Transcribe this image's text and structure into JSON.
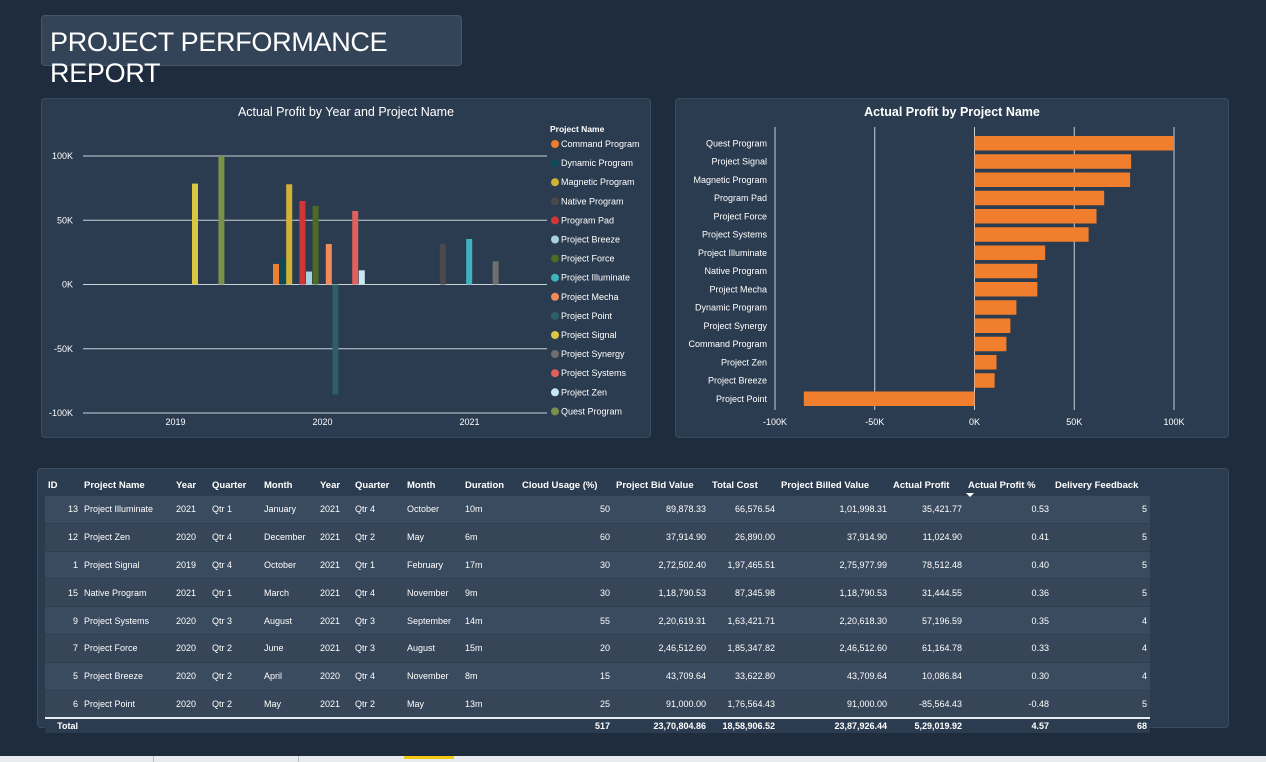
{
  "report": {
    "title": "PROJECT PERFORMANCE REPORT"
  },
  "colors": {
    "background": "#1e2c3d",
    "panel": "#2c3c50",
    "bar_orange": "#f07e2c"
  },
  "chart_data": [
    {
      "type": "bar",
      "title": "Actual Profit by Year and Project Name",
      "categories": [
        "2019",
        "2020",
        "2021"
      ],
      "ylim": [
        -100000,
        100000
      ],
      "yticks": [
        -100000,
        -50000,
        0,
        50000,
        100000
      ],
      "ytick_labels": [
        "-100K",
        "-50K",
        "0K",
        "50K",
        "100K"
      ],
      "grid": true,
      "legend": {
        "title": "Project Name",
        "placement": "right"
      },
      "series": [
        {
          "name": "Command Program",
          "color": "#f07e2c",
          "values": [
            0,
            16000,
            0
          ]
        },
        {
          "name": "Dynamic Program",
          "color": "#0e4a5a",
          "values": [
            0,
            20000,
            0
          ]
        },
        {
          "name": "Magnetic Program",
          "color": "#d2b234",
          "values": [
            0,
            78000,
            0
          ]
        },
        {
          "name": "Native Program",
          "color": "#4a4a4a",
          "values": [
            0,
            0,
            31444.55
          ]
        },
        {
          "name": "Program Pad",
          "color": "#d03538",
          "values": [
            0,
            65000,
            0
          ]
        },
        {
          "name": "Project Breeze",
          "color": "#a7d2e0",
          "values": [
            0,
            10086.84,
            0
          ]
        },
        {
          "name": "Project Force",
          "color": "#4d6b24",
          "values": [
            0,
            61164.78,
            0
          ]
        },
        {
          "name": "Project Illuminate",
          "color": "#3fb3bd",
          "values": [
            0,
            0,
            35421.77
          ]
        },
        {
          "name": "Project Mecha",
          "color": "#f08c5a",
          "values": [
            0,
            31500,
            0
          ]
        },
        {
          "name": "Project Point",
          "color": "#2d5e69",
          "values": [
            0,
            -85564.43,
            0
          ]
        },
        {
          "name": "Project Signal",
          "color": "#dcc743",
          "values": [
            78512.48,
            0,
            0
          ]
        },
        {
          "name": "Project Synergy",
          "color": "#6f6f6f",
          "values": [
            0,
            0,
            18000
          ]
        },
        {
          "name": "Project Systems",
          "color": "#e0605a",
          "values": [
            0,
            57196.59,
            0
          ]
        },
        {
          "name": "Project Zen",
          "color": "#c9e8f2",
          "values": [
            0,
            11024.9,
            0
          ]
        },
        {
          "name": "Quest Program",
          "color": "#7a904b",
          "values": [
            100000,
            0,
            0
          ]
        }
      ]
    },
    {
      "type": "bar",
      "orientation": "horizontal",
      "title": "Actual Profit by Project Name",
      "color": "#f07e2c",
      "xlim": [
        -100000,
        100000
      ],
      "xticks": [
        -100000,
        -50000,
        0,
        50000,
        100000
      ],
      "xtick_labels": [
        "-100K",
        "-50K",
        "0K",
        "50K",
        "100K"
      ],
      "grid": true,
      "categories": [
        "Quest Program",
        "Project Signal",
        "Magnetic Program",
        "Program Pad",
        "Project Force",
        "Project Systems",
        "Project Illuminate",
        "Native Program",
        "Project Mecha",
        "Dynamic Program",
        "Project Synergy",
        "Command Program",
        "Project Zen",
        "Project Breeze",
        "Project Point"
      ],
      "values": [
        100000,
        78512.48,
        78000,
        65000,
        61164.78,
        57196.59,
        35421.77,
        31444.55,
        31500,
        21000,
        18000,
        16000,
        11024.9,
        10086.84,
        -85564.43
      ]
    }
  ],
  "table": {
    "columns": [
      "ID",
      "Project Name",
      "Year",
      "Quarter",
      "Month",
      "Year",
      "Quarter",
      "Month",
      "Duration",
      "Cloud Usage (%)",
      "Project Bid Value",
      "Total Cost",
      "Project Billed Value",
      "Actual Profit",
      "Actual Profit %",
      "Delivery Feedback"
    ],
    "sorted_column": "Actual Profit %",
    "rows": [
      [
        "13",
        "Project Illuminate",
        "2021",
        "Qtr 1",
        "January",
        "2021",
        "Qtr 4",
        "October",
        "10m",
        "50",
        "89,878.33",
        "66,576.54",
        "1,01,998.31",
        "35,421.77",
        "0.53",
        "5"
      ],
      [
        "12",
        "Project Zen",
        "2020",
        "Qtr 4",
        "December",
        "2021",
        "Qtr 2",
        "May",
        "6m",
        "60",
        "37,914.90",
        "26,890.00",
        "37,914.90",
        "11,024.90",
        "0.41",
        "5"
      ],
      [
        "1",
        "Project Signal",
        "2019",
        "Qtr 4",
        "October",
        "2021",
        "Qtr 1",
        "February",
        "17m",
        "30",
        "2,72,502.40",
        "1,97,465.51",
        "2,75,977.99",
        "78,512.48",
        "0.40",
        "5"
      ],
      [
        "15",
        "Native Program",
        "2021",
        "Qtr 1",
        "March",
        "2021",
        "Qtr 4",
        "November",
        "9m",
        "30",
        "1,18,790.53",
        "87,345.98",
        "1,18,790.53",
        "31,444.55",
        "0.36",
        "5"
      ],
      [
        "9",
        "Project Systems",
        "2020",
        "Qtr 3",
        "August",
        "2021",
        "Qtr 3",
        "September",
        "14m",
        "55",
        "2,20,619.31",
        "1,63,421.71",
        "2,20,618.30",
        "57,196.59",
        "0.35",
        "4"
      ],
      [
        "7",
        "Project Force",
        "2020",
        "Qtr 2",
        "June",
        "2021",
        "Qtr 3",
        "August",
        "15m",
        "20",
        "2,46,512.60",
        "1,85,347.82",
        "2,46,512.60",
        "61,164.78",
        "0.33",
        "4"
      ],
      [
        "5",
        "Project Breeze",
        "2020",
        "Qtr 2",
        "April",
        "2020",
        "Qtr 4",
        "November",
        "8m",
        "15",
        "43,709.64",
        "33,622.80",
        "43,709.64",
        "10,086.84",
        "0.30",
        "4"
      ],
      [
        "6",
        "Project Point",
        "2020",
        "Qtr 2",
        "May",
        "2021",
        "Qtr 2",
        "May",
        "13m",
        "25",
        "91,000.00",
        "1,76,564.43",
        "91,000.00",
        "-85,564.43",
        "-0.48",
        "5"
      ]
    ],
    "total": [
      "Total",
      "",
      "",
      "",
      "",
      "",
      "",
      "",
      "",
      "517",
      "23,70,804.86",
      "18,58,906.52",
      "23,87,926.44",
      "5,29,019.92",
      "4.57",
      "68"
    ]
  }
}
